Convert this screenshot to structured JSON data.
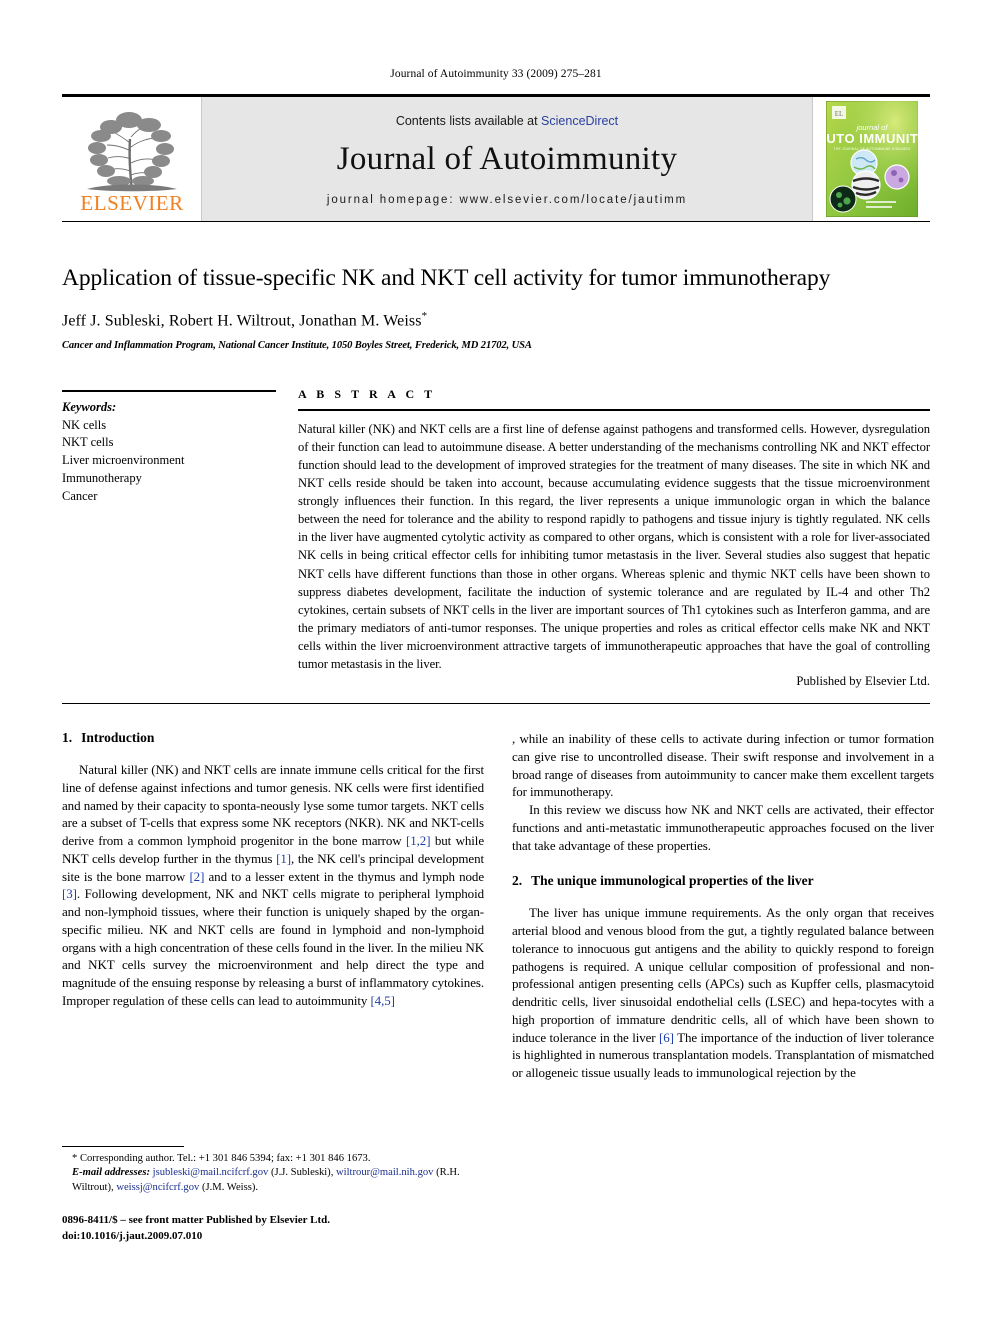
{
  "running_head": "Journal of Autoimmunity 33 (2009) 275–281",
  "masthead": {
    "publisher_logo_name": "ELSEVIER",
    "contents_prefix": "Contents lists available at",
    "contents_link": "ScienceDirect",
    "journal_name": "Journal of Autoimmunity",
    "homepage": "journal homepage: www.elsevier.com/locate/jautimm",
    "cover": {
      "line1": "journal of",
      "line2": "AUTO",
      "line3": "IMMUNITY",
      "subtitle": "THE JOURNAL OF AUTOIMMUNE DISEASES",
      "bg_color": "#a6ce39",
      "accent_color": "#7fb800"
    },
    "link_color": "#2b3fa0"
  },
  "article": {
    "title": "Application of tissue-specific NK and NKT cell activity for tumor immunotherapy",
    "authors": "Jeff J. Subleski, Robert H. Wiltrout, Jonathan M. Weiss",
    "corresponding_marker": "*",
    "affiliation": "Cancer and Inflammation Program, National Cancer Institute, 1050 Boyles Street, Frederick, MD 21702, USA"
  },
  "keywords": {
    "label": "Keywords:",
    "items": [
      "NK cells",
      "NKT cells",
      "Liver microenvironment",
      "Immunotherapy",
      "Cancer"
    ]
  },
  "abstract": {
    "label": "A B S T R A C T",
    "text": "Natural killer (NK) and NKT cells are a first line of defense against pathogens and transformed cells. However, dysregulation of their function can lead to autoimmune disease. A better understanding of the mechanisms controlling NK and NKT effector function should lead to the development of improved strategies for the treatment of many diseases. The site in which NK and NKT cells reside should be taken into account, because accumulating evidence suggests that the tissue microenvironment strongly influences their function. In this regard, the liver represents a unique immunologic organ in which the balance between the need for tolerance and the ability to respond rapidly to pathogens and tissue injury is tightly regulated. NK cells in the liver have augmented cytolytic activity as compared to other organs, which is consistent with a role for liver-associated NK cells in being critical effector cells for inhibiting tumor metastasis in the liver. Several studies also suggest that hepatic NKT cells have different functions than those in other organs. Whereas splenic and thymic NKT cells have been shown to suppress diabetes development, facilitate the induction of systemic tolerance and are regulated by IL-4 and other Th2 cytokines, certain subsets of NKT cells in the liver are important sources of Th1 cytokines such as Interferon gamma, and are the primary mediators of anti-tumor responses. The unique properties and roles as critical effector cells make NK and NKT cells within the liver microenvironment attractive targets of immunotherapeutic approaches that have the goal of controlling tumor metastasis in the liver.",
    "signature": "Published by Elsevier Ltd."
  },
  "sections": {
    "intro": {
      "number": "1.",
      "title": "Introduction",
      "p1_a": "Natural killer (NK) and NKT cells are innate immune cells critical for the first line of defense against infections and tumor genesis. NK cells were first identified and named by their capacity to sponta-neously lyse some tumor targets. NKT cells are a subset of T-cells that express some NK receptors (NKR). NK and NKT-cells derive from a common lymphoid progenitor in the bone marrow ",
      "ref1": "[1,2]",
      "p1_b": " but while NKT cells develop further in the thymus ",
      "ref2": "[1]",
      "p1_c": ", the NK cell's principal development site is the bone marrow ",
      "ref3": "[2]",
      "p1_d": " and to a lesser extent in the thymus and lymph node ",
      "ref4": "[3]",
      "p1_e": ". Following development, NK and NKT cells migrate to peripheral lymphoid and non-lymphoid tissues, where their function is uniquely shaped by the organ-specific milieu. NK and NKT cells are found in lymphoid and non-lymphoid organs with a high concentration of these cells found in the liver. In the milieu NK and NKT cells survey the microenvironment and help direct the type and magnitude of the ensuing response by releasing a burst of inflammatory cytokines. Improper regulation of these cells can lead to autoimmunity ",
      "ref5": "[4,5]",
      "p1_f": ", while an inability of these cells to activate during infection or tumor formation can give rise to uncontrolled disease. Their swift response and involvement in a broad range of diseases from autoimmunity to cancer make them excellent targets for immunotherapy.",
      "p2": "In this review we discuss how NK and NKT cells are activated, their effector functions and anti-metastatic immunotherapeutic approaches focused on the liver that take advantage of these properties."
    },
    "liver": {
      "number": "2.",
      "title": "The unique immunological properties of the liver",
      "p1_a": "The liver has unique immune requirements. As the only organ that receives arterial blood and venous blood from the gut, a tightly regulated balance between tolerance to innocuous gut antigens and the ability to quickly respond to foreign pathogens is required. A unique cellular composition of professional and non-professional antigen presenting cells (APCs) such as Kupffer cells, plasmacytoid dendritic cells, liver sinusoidal endothelial cells (LSEC) and hepa-tocytes with a high proportion of immature dendritic cells, all of which have been shown to induce tolerance in the liver ",
      "ref1": "[6]",
      "p1_b": " The importance of the induction of liver tolerance is highlighted in numerous transplantation models. Transplantation of mismatched or allogeneic tissue usually leads to immunological rejection by the"
    }
  },
  "footnote": {
    "corresponding": "* Corresponding author. Tel.: +1 301 846 5394; fax: +1 301 846 1673.",
    "email_label": "E-mail addresses:",
    "emails": [
      {
        "address": "jsubleski@mail.ncifcrf.gov",
        "owner": "(J.J. Subleski),"
      },
      {
        "address": "wiltrour@mail.nih.gov",
        "owner": "(R.H. Wiltrout),"
      },
      {
        "address": "weissj@ncifcrf.gov",
        "owner": "(J.M. Weiss)."
      }
    ],
    "link_color": "#1c2f8c"
  },
  "footer": {
    "issn_line": "0896-8411/$ – see front matter Published by Elsevier Ltd.",
    "doi_line": "doi:10.1016/j.jaut.2009.07.010"
  }
}
